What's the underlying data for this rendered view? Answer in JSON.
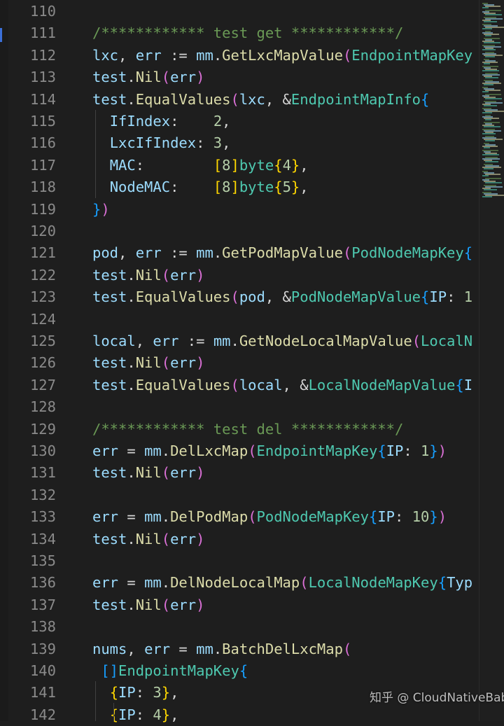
{
  "editor": {
    "lines": [
      {
        "no": "110",
        "tokens": []
      },
      {
        "no": "111",
        "tokens": [
          {
            "t": "/************ test get ************/",
            "c": "#6a9955"
          }
        ]
      },
      {
        "no": "112",
        "tokens": [
          {
            "t": "lxc",
            "c": "#9cdcfe"
          },
          {
            "t": ", ",
            "c": "#d4d4d4"
          },
          {
            "t": "err",
            "c": "#9cdcfe"
          },
          {
            "t": " := ",
            "c": "#d4d4d4"
          },
          {
            "t": "mm",
            "c": "#9cdcfe"
          },
          {
            "t": ".",
            "c": "#d4d4d4"
          },
          {
            "t": "GetLxcMapValue",
            "c": "#dcdcaa"
          },
          {
            "t": "(",
            "c": "#da70d6"
          },
          {
            "t": "EndpointMapKey",
            "c": "#4ec9b0"
          }
        ]
      },
      {
        "no": "113",
        "tokens": [
          {
            "t": "test",
            "c": "#9cdcfe"
          },
          {
            "t": ".",
            "c": "#d4d4d4"
          },
          {
            "t": "Nil",
            "c": "#dcdcaa"
          },
          {
            "t": "(",
            "c": "#da70d6"
          },
          {
            "t": "err",
            "c": "#9cdcfe"
          },
          {
            "t": ")",
            "c": "#da70d6"
          }
        ]
      },
      {
        "no": "114",
        "tokens": [
          {
            "t": "test",
            "c": "#9cdcfe"
          },
          {
            "t": ".",
            "c": "#d4d4d4"
          },
          {
            "t": "EqualValues",
            "c": "#dcdcaa"
          },
          {
            "t": "(",
            "c": "#da70d6"
          },
          {
            "t": "lxc",
            "c": "#9cdcfe"
          },
          {
            "t": ", &",
            "c": "#d4d4d4"
          },
          {
            "t": "EndpointMapInfo",
            "c": "#4ec9b0"
          },
          {
            "t": "{",
            "c": "#179fff"
          }
        ]
      },
      {
        "no": "115",
        "tokens": [
          {
            "t": "  ",
            "c": "#d4d4d4"
          },
          {
            "t": "IfIndex",
            "c": "#9cdcfe"
          },
          {
            "t": ":    ",
            "c": "#d4d4d4"
          },
          {
            "t": "2",
            "c": "#b5cea8"
          },
          {
            "t": ",",
            "c": "#d4d4d4"
          }
        ]
      },
      {
        "no": "116",
        "tokens": [
          {
            "t": "  ",
            "c": "#d4d4d4"
          },
          {
            "t": "LxcIfIndex",
            "c": "#9cdcfe"
          },
          {
            "t": ": ",
            "c": "#d4d4d4"
          },
          {
            "t": "3",
            "c": "#b5cea8"
          },
          {
            "t": ",",
            "c": "#d4d4d4"
          }
        ]
      },
      {
        "no": "117",
        "tokens": [
          {
            "t": "  ",
            "c": "#d4d4d4"
          },
          {
            "t": "MAC",
            "c": "#9cdcfe"
          },
          {
            "t": ":        ",
            "c": "#d4d4d4"
          },
          {
            "t": "[",
            "c": "#ffd700"
          },
          {
            "t": "8",
            "c": "#b5cea8"
          },
          {
            "t": "]",
            "c": "#ffd700"
          },
          {
            "t": "byte",
            "c": "#4ec9b0"
          },
          {
            "t": "{",
            "c": "#ffd700"
          },
          {
            "t": "4",
            "c": "#b5cea8"
          },
          {
            "t": "}",
            "c": "#ffd700"
          },
          {
            "t": ",",
            "c": "#d4d4d4"
          }
        ]
      },
      {
        "no": "118",
        "tokens": [
          {
            "t": "  ",
            "c": "#d4d4d4"
          },
          {
            "t": "NodeMAC",
            "c": "#9cdcfe"
          },
          {
            "t": ":    ",
            "c": "#d4d4d4"
          },
          {
            "t": "[",
            "c": "#ffd700"
          },
          {
            "t": "8",
            "c": "#b5cea8"
          },
          {
            "t": "]",
            "c": "#ffd700"
          },
          {
            "t": "byte",
            "c": "#4ec9b0"
          },
          {
            "t": "{",
            "c": "#ffd700"
          },
          {
            "t": "5",
            "c": "#b5cea8"
          },
          {
            "t": "}",
            "c": "#ffd700"
          },
          {
            "t": ",",
            "c": "#d4d4d4"
          }
        ]
      },
      {
        "no": "119",
        "tokens": [
          {
            "t": "}",
            "c": "#179fff"
          },
          {
            "t": ")",
            "c": "#da70d6"
          }
        ]
      },
      {
        "no": "120",
        "tokens": []
      },
      {
        "no": "121",
        "tokens": [
          {
            "t": "pod",
            "c": "#9cdcfe"
          },
          {
            "t": ", ",
            "c": "#d4d4d4"
          },
          {
            "t": "err",
            "c": "#9cdcfe"
          },
          {
            "t": " := ",
            "c": "#d4d4d4"
          },
          {
            "t": "mm",
            "c": "#9cdcfe"
          },
          {
            "t": ".",
            "c": "#d4d4d4"
          },
          {
            "t": "GetPodMapValue",
            "c": "#dcdcaa"
          },
          {
            "t": "(",
            "c": "#da70d6"
          },
          {
            "t": "PodNodeMapKey",
            "c": "#4ec9b0"
          },
          {
            "t": "{",
            "c": "#179fff"
          }
        ]
      },
      {
        "no": "122",
        "tokens": [
          {
            "t": "test",
            "c": "#9cdcfe"
          },
          {
            "t": ".",
            "c": "#d4d4d4"
          },
          {
            "t": "Nil",
            "c": "#dcdcaa"
          },
          {
            "t": "(",
            "c": "#da70d6"
          },
          {
            "t": "err",
            "c": "#9cdcfe"
          },
          {
            "t": ")",
            "c": "#da70d6"
          }
        ]
      },
      {
        "no": "123",
        "tokens": [
          {
            "t": "test",
            "c": "#9cdcfe"
          },
          {
            "t": ".",
            "c": "#d4d4d4"
          },
          {
            "t": "EqualValues",
            "c": "#dcdcaa"
          },
          {
            "t": "(",
            "c": "#da70d6"
          },
          {
            "t": "pod",
            "c": "#9cdcfe"
          },
          {
            "t": ", &",
            "c": "#d4d4d4"
          },
          {
            "t": "PodNodeMapValue",
            "c": "#4ec9b0"
          },
          {
            "t": "{",
            "c": "#179fff"
          },
          {
            "t": "IP",
            "c": "#9cdcfe"
          },
          {
            "t": ": ",
            "c": "#d4d4d4"
          },
          {
            "t": "1",
            "c": "#b5cea8"
          }
        ]
      },
      {
        "no": "124",
        "tokens": []
      },
      {
        "no": "125",
        "tokens": [
          {
            "t": "local",
            "c": "#9cdcfe"
          },
          {
            "t": ", ",
            "c": "#d4d4d4"
          },
          {
            "t": "err",
            "c": "#9cdcfe"
          },
          {
            "t": " := ",
            "c": "#d4d4d4"
          },
          {
            "t": "mm",
            "c": "#9cdcfe"
          },
          {
            "t": ".",
            "c": "#d4d4d4"
          },
          {
            "t": "GetNodeLocalMapValue",
            "c": "#dcdcaa"
          },
          {
            "t": "(",
            "c": "#da70d6"
          },
          {
            "t": "LocalN",
            "c": "#4ec9b0"
          }
        ]
      },
      {
        "no": "126",
        "tokens": [
          {
            "t": "test",
            "c": "#9cdcfe"
          },
          {
            "t": ".",
            "c": "#d4d4d4"
          },
          {
            "t": "Nil",
            "c": "#dcdcaa"
          },
          {
            "t": "(",
            "c": "#da70d6"
          },
          {
            "t": "err",
            "c": "#9cdcfe"
          },
          {
            "t": ")",
            "c": "#da70d6"
          }
        ]
      },
      {
        "no": "127",
        "tokens": [
          {
            "t": "test",
            "c": "#9cdcfe"
          },
          {
            "t": ".",
            "c": "#d4d4d4"
          },
          {
            "t": "EqualValues",
            "c": "#dcdcaa"
          },
          {
            "t": "(",
            "c": "#da70d6"
          },
          {
            "t": "local",
            "c": "#9cdcfe"
          },
          {
            "t": ", &",
            "c": "#d4d4d4"
          },
          {
            "t": "LocalNodeMapValue",
            "c": "#4ec9b0"
          },
          {
            "t": "{",
            "c": "#179fff"
          },
          {
            "t": "I",
            "c": "#9cdcfe"
          }
        ]
      },
      {
        "no": "128",
        "tokens": []
      },
      {
        "no": "129",
        "tokens": [
          {
            "t": "/************ test del ************/",
            "c": "#6a9955"
          }
        ]
      },
      {
        "no": "130",
        "tokens": [
          {
            "t": "err",
            "c": "#9cdcfe"
          },
          {
            "t": " = ",
            "c": "#d4d4d4"
          },
          {
            "t": "mm",
            "c": "#9cdcfe"
          },
          {
            "t": ".",
            "c": "#d4d4d4"
          },
          {
            "t": "DelLxcMap",
            "c": "#dcdcaa"
          },
          {
            "t": "(",
            "c": "#da70d6"
          },
          {
            "t": "EndpointMapKey",
            "c": "#4ec9b0"
          },
          {
            "t": "{",
            "c": "#179fff"
          },
          {
            "t": "IP",
            "c": "#9cdcfe"
          },
          {
            "t": ": ",
            "c": "#d4d4d4"
          },
          {
            "t": "1",
            "c": "#b5cea8"
          },
          {
            "t": "}",
            "c": "#179fff"
          },
          {
            "t": ")",
            "c": "#da70d6"
          }
        ]
      },
      {
        "no": "131",
        "tokens": [
          {
            "t": "test",
            "c": "#9cdcfe"
          },
          {
            "t": ".",
            "c": "#d4d4d4"
          },
          {
            "t": "Nil",
            "c": "#dcdcaa"
          },
          {
            "t": "(",
            "c": "#da70d6"
          },
          {
            "t": "err",
            "c": "#9cdcfe"
          },
          {
            "t": ")",
            "c": "#da70d6"
          }
        ]
      },
      {
        "no": "132",
        "tokens": []
      },
      {
        "no": "133",
        "tokens": [
          {
            "t": "err",
            "c": "#9cdcfe"
          },
          {
            "t": " = ",
            "c": "#d4d4d4"
          },
          {
            "t": "mm",
            "c": "#9cdcfe"
          },
          {
            "t": ".",
            "c": "#d4d4d4"
          },
          {
            "t": "DelPodMap",
            "c": "#dcdcaa"
          },
          {
            "t": "(",
            "c": "#da70d6"
          },
          {
            "t": "PodNodeMapKey",
            "c": "#4ec9b0"
          },
          {
            "t": "{",
            "c": "#179fff"
          },
          {
            "t": "IP",
            "c": "#9cdcfe"
          },
          {
            "t": ": ",
            "c": "#d4d4d4"
          },
          {
            "t": "10",
            "c": "#b5cea8"
          },
          {
            "t": "}",
            "c": "#179fff"
          },
          {
            "t": ")",
            "c": "#da70d6"
          }
        ]
      },
      {
        "no": "134",
        "tokens": [
          {
            "t": "test",
            "c": "#9cdcfe"
          },
          {
            "t": ".",
            "c": "#d4d4d4"
          },
          {
            "t": "Nil",
            "c": "#dcdcaa"
          },
          {
            "t": "(",
            "c": "#da70d6"
          },
          {
            "t": "err",
            "c": "#9cdcfe"
          },
          {
            "t": ")",
            "c": "#da70d6"
          }
        ]
      },
      {
        "no": "135",
        "tokens": []
      },
      {
        "no": "136",
        "tokens": [
          {
            "t": "err",
            "c": "#9cdcfe"
          },
          {
            "t": " = ",
            "c": "#d4d4d4"
          },
          {
            "t": "mm",
            "c": "#9cdcfe"
          },
          {
            "t": ".",
            "c": "#d4d4d4"
          },
          {
            "t": "DelNodeLocalMap",
            "c": "#dcdcaa"
          },
          {
            "t": "(",
            "c": "#da70d6"
          },
          {
            "t": "LocalNodeMapKey",
            "c": "#4ec9b0"
          },
          {
            "t": "{",
            "c": "#179fff"
          },
          {
            "t": "Typ",
            "c": "#9cdcfe"
          }
        ]
      },
      {
        "no": "137",
        "tokens": [
          {
            "t": "test",
            "c": "#9cdcfe"
          },
          {
            "t": ".",
            "c": "#d4d4d4"
          },
          {
            "t": "Nil",
            "c": "#dcdcaa"
          },
          {
            "t": "(",
            "c": "#da70d6"
          },
          {
            "t": "err",
            "c": "#9cdcfe"
          },
          {
            "t": ")",
            "c": "#da70d6"
          }
        ]
      },
      {
        "no": "138",
        "tokens": []
      },
      {
        "no": "139",
        "tokens": [
          {
            "t": "nums",
            "c": "#9cdcfe"
          },
          {
            "t": ", ",
            "c": "#d4d4d4"
          },
          {
            "t": "err",
            "c": "#9cdcfe"
          },
          {
            "t": " = ",
            "c": "#d4d4d4"
          },
          {
            "t": "mm",
            "c": "#9cdcfe"
          },
          {
            "t": ".",
            "c": "#d4d4d4"
          },
          {
            "t": "BatchDelLxcMap",
            "c": "#dcdcaa"
          },
          {
            "t": "(",
            "c": "#da70d6"
          }
        ]
      },
      {
        "no": "140",
        "tokens": [
          {
            "t": " ",
            "c": "#d4d4d4"
          },
          {
            "t": "[]",
            "c": "#179fff"
          },
          {
            "t": "EndpointMapKey",
            "c": "#4ec9b0"
          },
          {
            "t": "{",
            "c": "#179fff"
          }
        ]
      },
      {
        "no": "141",
        "tokens": [
          {
            "t": "  ",
            "c": "#d4d4d4"
          },
          {
            "t": "{",
            "c": "#ffd700"
          },
          {
            "t": "IP",
            "c": "#9cdcfe"
          },
          {
            "t": ": ",
            "c": "#d4d4d4"
          },
          {
            "t": "3",
            "c": "#b5cea8"
          },
          {
            "t": "}",
            "c": "#ffd700"
          },
          {
            "t": ",",
            "c": "#d4d4d4"
          }
        ]
      },
      {
        "no": "142",
        "tokens": [
          {
            "t": "  ",
            "c": "#d4d4d4"
          },
          {
            "t": "{",
            "c": "#ffd700"
          },
          {
            "t": "IP",
            "c": "#9cdcfe"
          },
          {
            "t": ": ",
            "c": "#d4d4d4"
          },
          {
            "t": "4",
            "c": "#b5cea8"
          },
          {
            "t": "}",
            "c": "#ffd700"
          },
          {
            "t": ",",
            "c": "#d4d4d4"
          }
        ]
      }
    ]
  },
  "watermark": {
    "text": "知乎 @ CloudNativeBaba"
  }
}
